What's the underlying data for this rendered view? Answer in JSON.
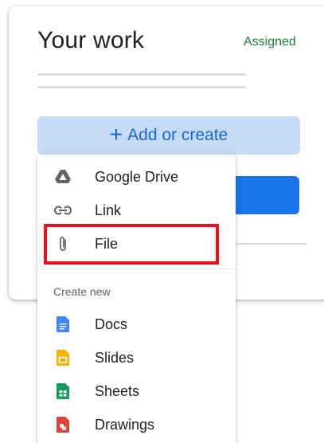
{
  "header": {
    "title": "Your work",
    "status": "Assigned"
  },
  "add_button": {
    "plus": "+",
    "label": "Add or create"
  },
  "menu": {
    "items": [
      {
        "label": "Google Drive",
        "icon": "google-drive-icon"
      },
      {
        "label": "Link",
        "icon": "link-icon"
      },
      {
        "label": "File",
        "icon": "paperclip-icon"
      }
    ],
    "section_label": "Create new",
    "create_items": [
      {
        "label": "Docs",
        "icon": "docs-icon",
        "color": "#4285f4"
      },
      {
        "label": "Slides",
        "icon": "slides-icon",
        "color": "#f4b400"
      },
      {
        "label": "Sheets",
        "icon": "sheets-icon",
        "color": "#0f9d58"
      },
      {
        "label": "Drawings",
        "icon": "drawings-icon",
        "color": "#db4437"
      }
    ]
  },
  "colors": {
    "accent": "#1a73e8",
    "status_green": "#188038",
    "highlight_red": "#e8131a"
  }
}
